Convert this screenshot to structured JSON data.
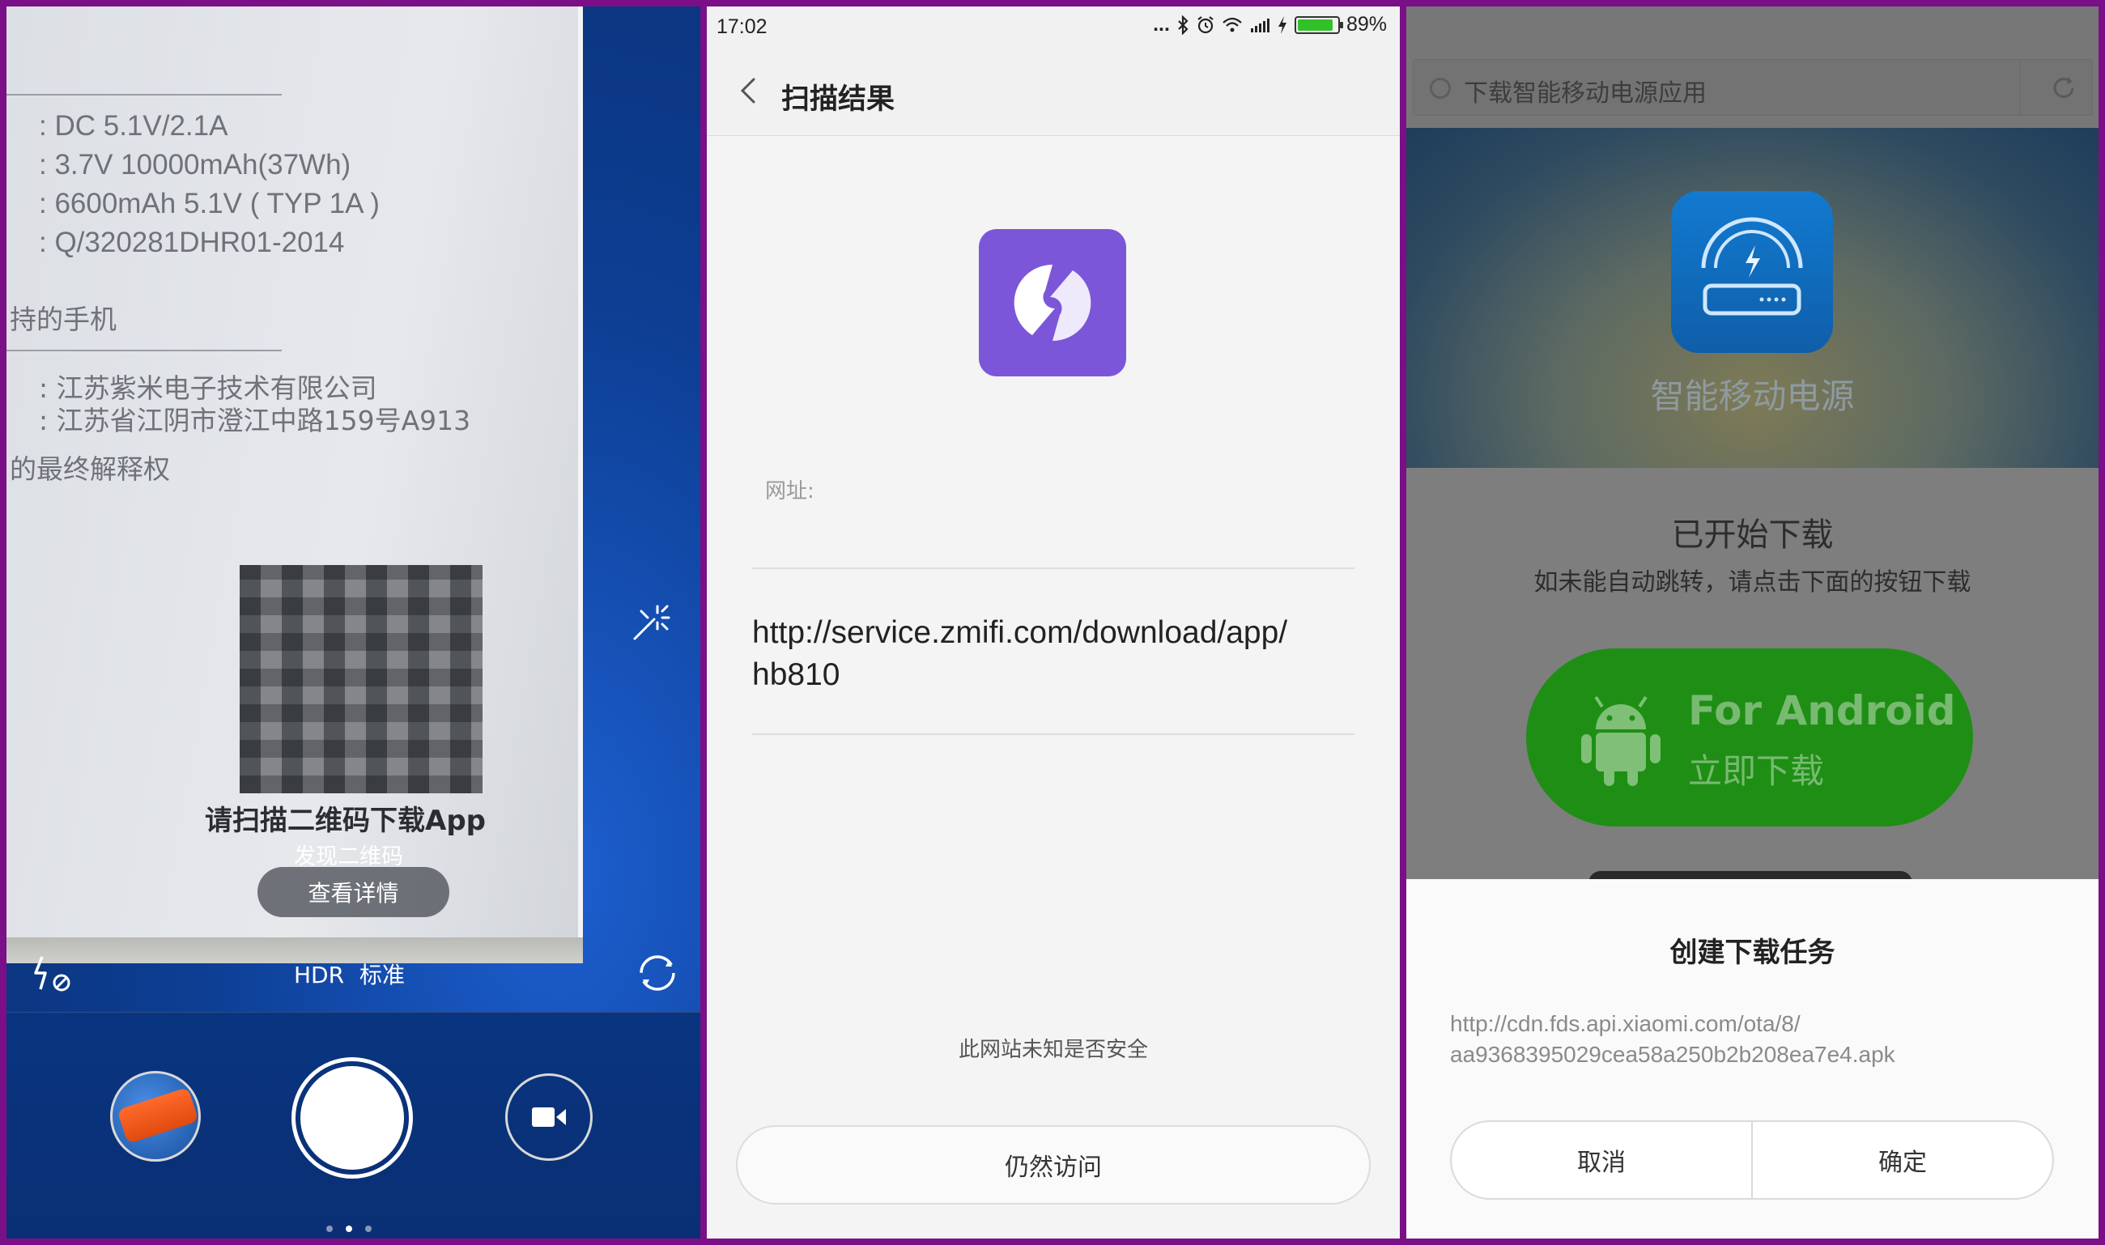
{
  "camera": {
    "box_lines": [
      ": DC 5.1V/2.1A",
      ": 3.7V  10000mAh(37Wh)",
      ": 6600mAh 5.1V ( TYP 1A )",
      ": Q/320281DHR01-2014",
      "持的手机",
      ": 江苏紫米电子技术有限公司",
      ": 江苏省江阴市澄江中路159号A913",
      "的最终解释权"
    ],
    "qr_caption": "请扫描二维码下载App",
    "found_label": "发现二维码",
    "detail_button": "查看详情",
    "hdr_label": "HDR",
    "mode_label": "标准",
    "pager_dots": 3,
    "pager_active_index": 1
  },
  "scan": {
    "status": {
      "time": "17:02",
      "dots": "...",
      "battery": "89%",
      "battery_level": 0.89
    },
    "title": "扫描结果",
    "url_label": "网址:",
    "url_line1": "http://service.zmifi.com/download/app/",
    "url_line2": "hb810",
    "unsafe_note": "此网站未知是否安全",
    "visit_button": "仍然访问",
    "logo_color": "#7c56d8"
  },
  "download": {
    "page_title": "下载智能移动电源应用",
    "app_name": "智能移动电源",
    "started": "已开始下载",
    "hint": "如未能自动跳转，请点击下面的按钮下载",
    "android_line1": "For Android",
    "android_line2": "立即下载",
    "sheet_title": "创建下载任务",
    "sheet_url_line1": "http://cdn.fds.api.xiaomi.com/ota/8/",
    "sheet_url_line2": "aa9368395029cea58a250b2b208ea7e4.apk",
    "cancel_button": "取消",
    "confirm_button": "确定",
    "accent_green": "#1e8f14"
  }
}
